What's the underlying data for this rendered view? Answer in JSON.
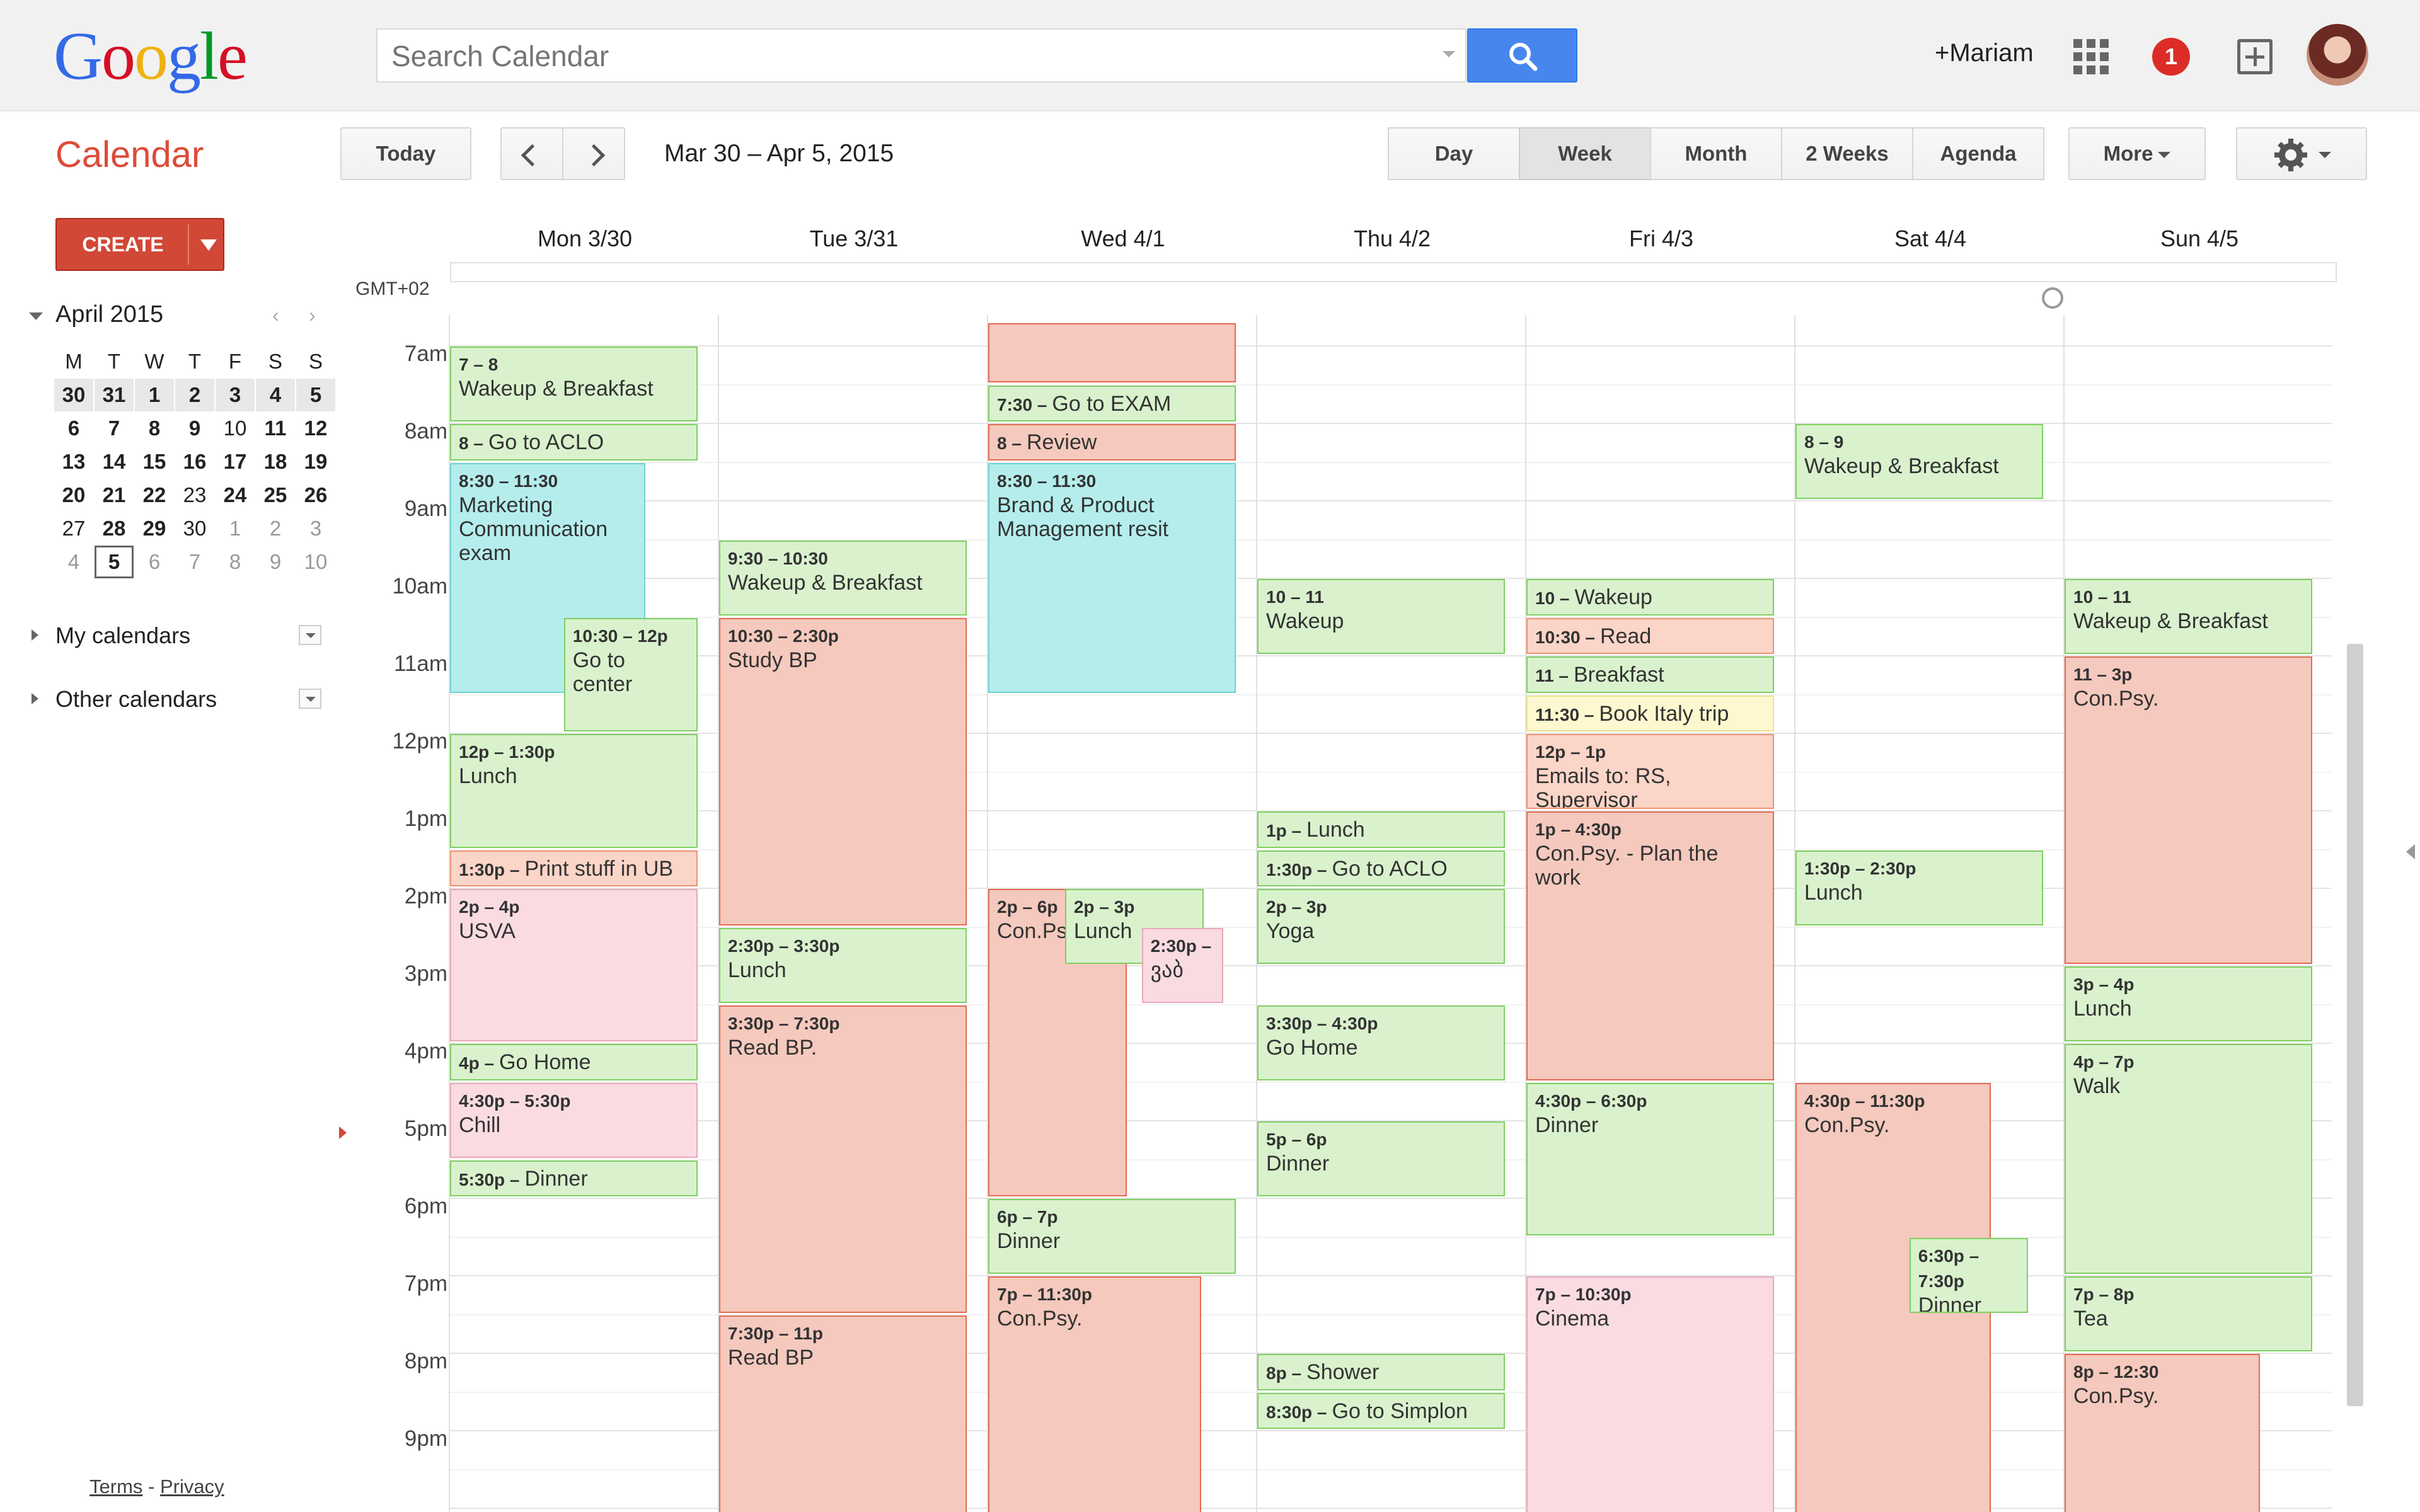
{
  "header": {
    "logo": {
      "text": "Google",
      "letters": [
        "G",
        "o",
        "o",
        "g",
        "l",
        "e"
      ],
      "colors": [
        "#3369e8",
        "#d50f25",
        "#eeb211",
        "#3369e8",
        "#009925",
        "#d50f25"
      ]
    },
    "search": {
      "placeholder": "Search Calendar"
    },
    "user": "+Mariam",
    "notifications": "1"
  },
  "toolbar": {
    "title": "Calendar",
    "today": "Today",
    "date_range": "Mar 30 – Apr 5, 2015",
    "views": [
      "Day",
      "Week",
      "Month",
      "2 Weeks",
      "Agenda"
    ],
    "selected_view": "Week",
    "more": "More"
  },
  "sidebar": {
    "create": "CREATE",
    "mini_calendar": {
      "month": "April 2015",
      "weekdays": [
        "M",
        "T",
        "W",
        "T",
        "F",
        "S",
        "S"
      ],
      "weeks": [
        [
          [
            "30",
            "b"
          ],
          [
            "31",
            "b"
          ],
          [
            "1",
            "b"
          ],
          [
            "2",
            "b"
          ],
          [
            "3",
            "b"
          ],
          [
            "4",
            "b"
          ],
          [
            "5",
            "b"
          ]
        ],
        [
          [
            "6",
            "b"
          ],
          [
            "7",
            "b"
          ],
          [
            "8",
            "b"
          ],
          [
            "9",
            "b"
          ],
          [
            "10",
            "n"
          ],
          [
            "11",
            "b"
          ],
          [
            "12",
            "b"
          ]
        ],
        [
          [
            "13",
            "b"
          ],
          [
            "14",
            "b"
          ],
          [
            "15",
            "b"
          ],
          [
            "16",
            "b"
          ],
          [
            "17",
            "b"
          ],
          [
            "18",
            "b"
          ],
          [
            "19",
            "b"
          ]
        ],
        [
          [
            "20",
            "b"
          ],
          [
            "21",
            "b"
          ],
          [
            "22",
            "b"
          ],
          [
            "23",
            "n"
          ],
          [
            "24",
            "b"
          ],
          [
            "25",
            "b"
          ],
          [
            "26",
            "b"
          ]
        ],
        [
          [
            "27",
            "n"
          ],
          [
            "28",
            "b"
          ],
          [
            "29",
            "b"
          ],
          [
            "30",
            "n"
          ],
          [
            "1",
            "g"
          ],
          [
            "2",
            "g"
          ],
          [
            "3",
            "g"
          ]
        ],
        [
          [
            "4",
            "g"
          ],
          [
            "5",
            "today"
          ],
          [
            "6",
            "g"
          ],
          [
            "7",
            "g"
          ],
          [
            "8",
            "g"
          ],
          [
            "9",
            "g"
          ],
          [
            "10",
            "g"
          ]
        ]
      ]
    },
    "my_calendars": "My calendars",
    "other_calendars": "Other calendars",
    "footer": {
      "terms": "Terms",
      "separator": " - ",
      "privacy": "Privacy"
    }
  },
  "calendar": {
    "timezone": "GMT+02",
    "days": [
      "Mon 3/30",
      "Tue 3/31",
      "Wed 4/1",
      "Thu 4/2",
      "Fri 4/3",
      "Sat 4/4",
      "Sun 4/5"
    ],
    "hours": [
      "7am",
      "8am",
      "9am",
      "10am",
      "11am",
      "12pm",
      "1pm",
      "2pm",
      "3pm",
      "4pm",
      "5pm",
      "6pm",
      "7pm",
      "8pm",
      "9pm"
    ],
    "events": [
      {
        "day": 0,
        "start": 7,
        "end": 8,
        "time": "7 – 8",
        "title": "Wakeup & Breakfast",
        "color": "green"
      },
      {
        "day": 0,
        "start": 8,
        "end": 8.5,
        "time": "8 –",
        "title": "Go to ACLO",
        "color": "green",
        "inline": true
      },
      {
        "day": 0,
        "start": 8.5,
        "end": 11.5,
        "time": "8:30 – 11:30",
        "title": "Marketing Communication exam",
        "color": "cyan",
        "w": 0.79
      },
      {
        "day": 0,
        "start": 10.5,
        "end": 12,
        "time": "10:30 – 12p",
        "title": "Go to center",
        "color": "green",
        "l": 0.46,
        "w": 0.54
      },
      {
        "day": 0,
        "start": 12,
        "end": 13.5,
        "time": "12p – 1:30p",
        "title": "Lunch",
        "color": "green"
      },
      {
        "day": 0,
        "start": 13.5,
        "end": 14,
        "time": "1:30p –",
        "title": "Print stuff in UB",
        "color": "peach",
        "inline": true
      },
      {
        "day": 0,
        "start": 14,
        "end": 16,
        "time": "2p – 4p",
        "title": "USVA",
        "color": "pink"
      },
      {
        "day": 0,
        "start": 16,
        "end": 16.5,
        "time": "4p –",
        "title": "Go Home",
        "color": "green",
        "inline": true
      },
      {
        "day": 0,
        "start": 16.5,
        "end": 17.5,
        "time": "4:30p – 5:30p",
        "title": "Chill",
        "color": "pink"
      },
      {
        "day": 0,
        "start": 17.5,
        "end": 18,
        "time": "5:30p –",
        "title": "Dinner",
        "color": "green",
        "inline": true
      },
      {
        "day": 1,
        "start": 9.5,
        "end": 10.5,
        "time": "9:30 – 10:30",
        "title": "Wakeup & Breakfast",
        "color": "green"
      },
      {
        "day": 1,
        "start": 10.5,
        "end": 14.5,
        "time": "10:30 – 2:30p",
        "title": "Study BP",
        "color": "red"
      },
      {
        "day": 1,
        "start": 14.5,
        "end": 15.5,
        "time": "2:30p – 3:30p",
        "title": "Lunch",
        "color": "green"
      },
      {
        "day": 1,
        "start": 15.5,
        "end": 19.5,
        "time": "3:30p – 7:30p",
        "title": "Read BP.",
        "color": "red"
      },
      {
        "day": 1,
        "start": 19.5,
        "end": 22.5,
        "time": "7:30p – 11p",
        "title": "Read BP",
        "color": "red"
      },
      {
        "day": 2,
        "start": 6.7,
        "end": 7.5,
        "time": "",
        "title": "",
        "color": "red"
      },
      {
        "day": 2,
        "start": 7.5,
        "end": 8,
        "time": "7:30 –",
        "title": "Go to EXAM",
        "color": "green",
        "inline": true
      },
      {
        "day": 2,
        "start": 8,
        "end": 8.5,
        "time": "8 –",
        "title": "Review",
        "color": "red",
        "inline": true
      },
      {
        "day": 2,
        "start": 8.5,
        "end": 11.5,
        "time": "8:30 – 11:30",
        "title": "Brand & Product Management resit",
        "color": "cyan"
      },
      {
        "day": 2,
        "start": 14,
        "end": 18,
        "time": "2p – 6p",
        "title": "Con.Psy.",
        "color": "red",
        "w": 0.56
      },
      {
        "day": 2,
        "start": 14,
        "end": 15,
        "time": "2p – 3p",
        "title": "Lunch",
        "color": "green",
        "l": 0.31,
        "w": 0.56
      },
      {
        "day": 2,
        "start": 14.5,
        "end": 15.5,
        "time": "2:30p –",
        "title": "ვაბ",
        "color": "pink",
        "l": 0.62,
        "w": 0.33
      },
      {
        "day": 2,
        "start": 18,
        "end": 19,
        "time": "6p – 7p",
        "title": "Dinner",
        "color": "green"
      },
      {
        "day": 2,
        "start": 19,
        "end": 22.5,
        "time": "7p – 11:30p",
        "title": "Con.Psy.",
        "color": "red",
        "w": 0.86
      },
      {
        "day": 3,
        "start": 10,
        "end": 11,
        "time": "10 – 11",
        "title": "Wakeup",
        "color": "green"
      },
      {
        "day": 3,
        "start": 13,
        "end": 13.5,
        "time": "1p –",
        "title": "Lunch",
        "color": "green",
        "inline": true
      },
      {
        "day": 3,
        "start": 13.5,
        "end": 14,
        "time": "1:30p –",
        "title": "Go to ACLO",
        "color": "green",
        "inline": true
      },
      {
        "day": 3,
        "start": 14,
        "end": 15,
        "time": "2p – 3p",
        "title": "Yoga",
        "color": "green"
      },
      {
        "day": 3,
        "start": 15.5,
        "end": 16.5,
        "time": "3:30p – 4:30p",
        "title": "Go Home",
        "color": "green"
      },
      {
        "day": 3,
        "start": 17,
        "end": 18,
        "time": "5p – 6p",
        "title": "Dinner",
        "color": "green"
      },
      {
        "day": 3,
        "start": 20,
        "end": 20.5,
        "time": "8p –",
        "title": "Shower",
        "color": "green",
        "inline": true
      },
      {
        "day": 3,
        "start": 20.5,
        "end": 21,
        "time": "8:30p –",
        "title": "Go to Simplon",
        "color": "green",
        "inline": true
      },
      {
        "day": 4,
        "start": 10,
        "end": 10.5,
        "time": "10 –",
        "title": "Wakeup",
        "color": "green",
        "inline": true
      },
      {
        "day": 4,
        "start": 10.5,
        "end": 11,
        "time": "10:30 –",
        "title": "Read",
        "color": "peach",
        "inline": true
      },
      {
        "day": 4,
        "start": 11,
        "end": 11.5,
        "time": "11 –",
        "title": "Breakfast",
        "color": "green",
        "inline": true
      },
      {
        "day": 4,
        "start": 11.5,
        "end": 12,
        "time": "11:30 –",
        "title": "Book Italy trip",
        "color": "yellow",
        "inline": true
      },
      {
        "day": 4,
        "start": 12,
        "end": 13,
        "time": "12p – 1p",
        "title": "Emails to: RS, Supervisor",
        "color": "peach"
      },
      {
        "day": 4,
        "start": 13,
        "end": 16.5,
        "time": "1p – 4:30p",
        "title": "Con.Psy. - Plan the work",
        "color": "red"
      },
      {
        "day": 4,
        "start": 16.5,
        "end": 18.5,
        "time": "4:30p – 6:30p",
        "title": "Dinner",
        "color": "green"
      },
      {
        "day": 4,
        "start": 19,
        "end": 22.5,
        "time": "7p – 10:30p",
        "title": "Cinema",
        "color": "pink"
      },
      {
        "day": 5,
        "start": 8,
        "end": 9,
        "time": "8 – 9",
        "title": "Wakeup & Breakfast",
        "color": "green"
      },
      {
        "day": 5,
        "start": 13.5,
        "end": 14.5,
        "time": "1:30p – 2:30p",
        "title": "Lunch",
        "color": "green"
      },
      {
        "day": 5,
        "start": 16.5,
        "end": 22.5,
        "time": "4:30p – 11:30p",
        "title": "Con.Psy.",
        "color": "red",
        "w": 0.79
      },
      {
        "day": 5,
        "start": 18.5,
        "end": 19.5,
        "time": "6:30p – 7:30p",
        "title": "Dinner",
        "color": "green",
        "l": 0.46,
        "w": 0.48
      },
      {
        "day": 6,
        "start": 10,
        "end": 11,
        "time": "10 – 11",
        "title": "Wakeup & Breakfast",
        "color": "green"
      },
      {
        "day": 6,
        "start": 11,
        "end": 15,
        "time": "11 – 3p",
        "title": "Con.Psy.",
        "color": "red"
      },
      {
        "day": 6,
        "start": 15,
        "end": 16,
        "time": "3p – 4p",
        "title": "Lunch",
        "color": "green"
      },
      {
        "day": 6,
        "start": 16,
        "end": 19,
        "time": "4p – 7p",
        "title": "Walk",
        "color": "green"
      },
      {
        "day": 6,
        "start": 19,
        "end": 20,
        "time": "7p – 8p",
        "title": "Tea",
        "color": "green"
      },
      {
        "day": 6,
        "start": 20,
        "end": 22.5,
        "time": "8p – 12:30",
        "title": "Con.Psy.",
        "color": "red",
        "w": 0.79
      }
    ]
  }
}
